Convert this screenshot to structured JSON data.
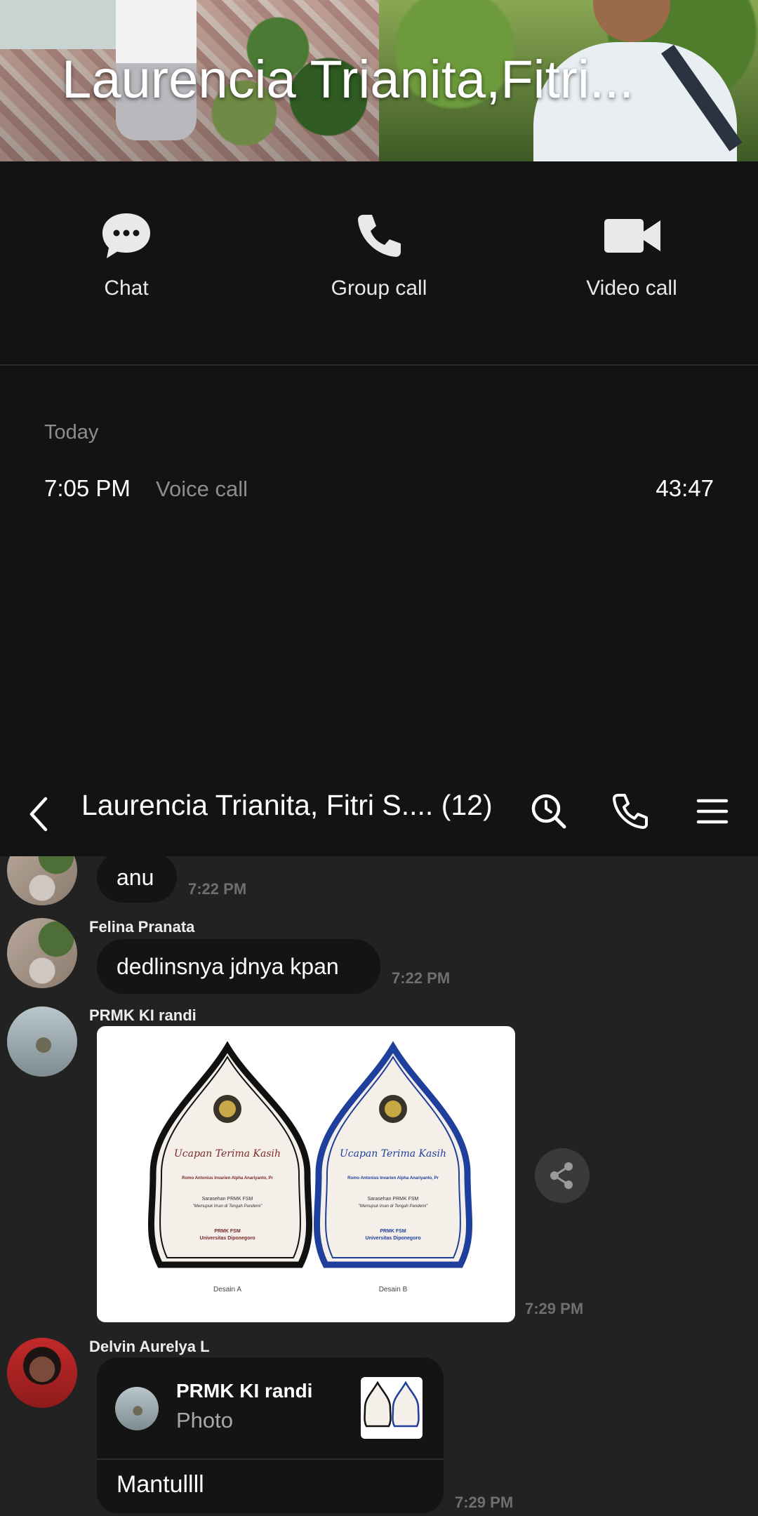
{
  "header": {
    "title": "Laurencia Trianita,Fitri..."
  },
  "actions": [
    {
      "label": "Chat",
      "icon": "chat-bubble-icon"
    },
    {
      "label": "Group call",
      "icon": "phone-icon"
    },
    {
      "label": "Video call",
      "icon": "video-camera-icon"
    }
  ],
  "call_log": {
    "day": "Today",
    "entries": [
      {
        "time": "7:05 PM",
        "type": "Voice call",
        "duration": "43:47"
      }
    ]
  },
  "chat_bar": {
    "title": "Laurencia Trianita, Fitri S.... (12)",
    "icons": [
      "back-arrow-icon",
      "search-icon",
      "phone-icon",
      "menu-icon"
    ]
  },
  "messages": [
    {
      "sender": "",
      "text": "anu",
      "time": "7:22 PM"
    },
    {
      "sender": "Felina Pranata",
      "text": "dedlinsnya jdnya kpan",
      "time": "7:22 PM"
    },
    {
      "sender": "PRMK KI randi",
      "type": "photo",
      "time": "7:29 PM",
      "photo": {
        "cards": [
          {
            "heading": "Ucapan Terima Kasih",
            "recipient": "Romo Antonius Invarien Alpha Anariyanto, Pr",
            "event": "Sarasehan PRMK FSM",
            "theme": "\"Memupuk Iman di Tengah Pandemi\"",
            "org": "PRMK FSM",
            "univ": "Universitas Diponegoro",
            "caption": "Desain A"
          },
          {
            "heading": "Ucapan Terima Kasih",
            "recipient": "Romo Antonius Invarien Alpha Anariyanto, Pr",
            "event": "Sarasehan PRMK FSM",
            "theme": "\"Memupuk Iman di Tengah Pandemi\"",
            "org": "PRMK FSM",
            "univ": "Universitas Diponegoro",
            "caption": "Desain B"
          }
        ]
      }
    },
    {
      "sender": "Delvin Aurelya L",
      "type": "reply",
      "time": "7:29 PM",
      "quoted": {
        "sender": "PRMK KI randi",
        "kind": "Photo"
      },
      "text": "Mantullll"
    }
  ],
  "colors": {
    "background": "#131313",
    "chat_background": "#222222",
    "bubble": "#141414",
    "muted_text": "#8d8d8d",
    "card_a_frame": "#111111",
    "card_b_frame": "#1f3f9c"
  }
}
